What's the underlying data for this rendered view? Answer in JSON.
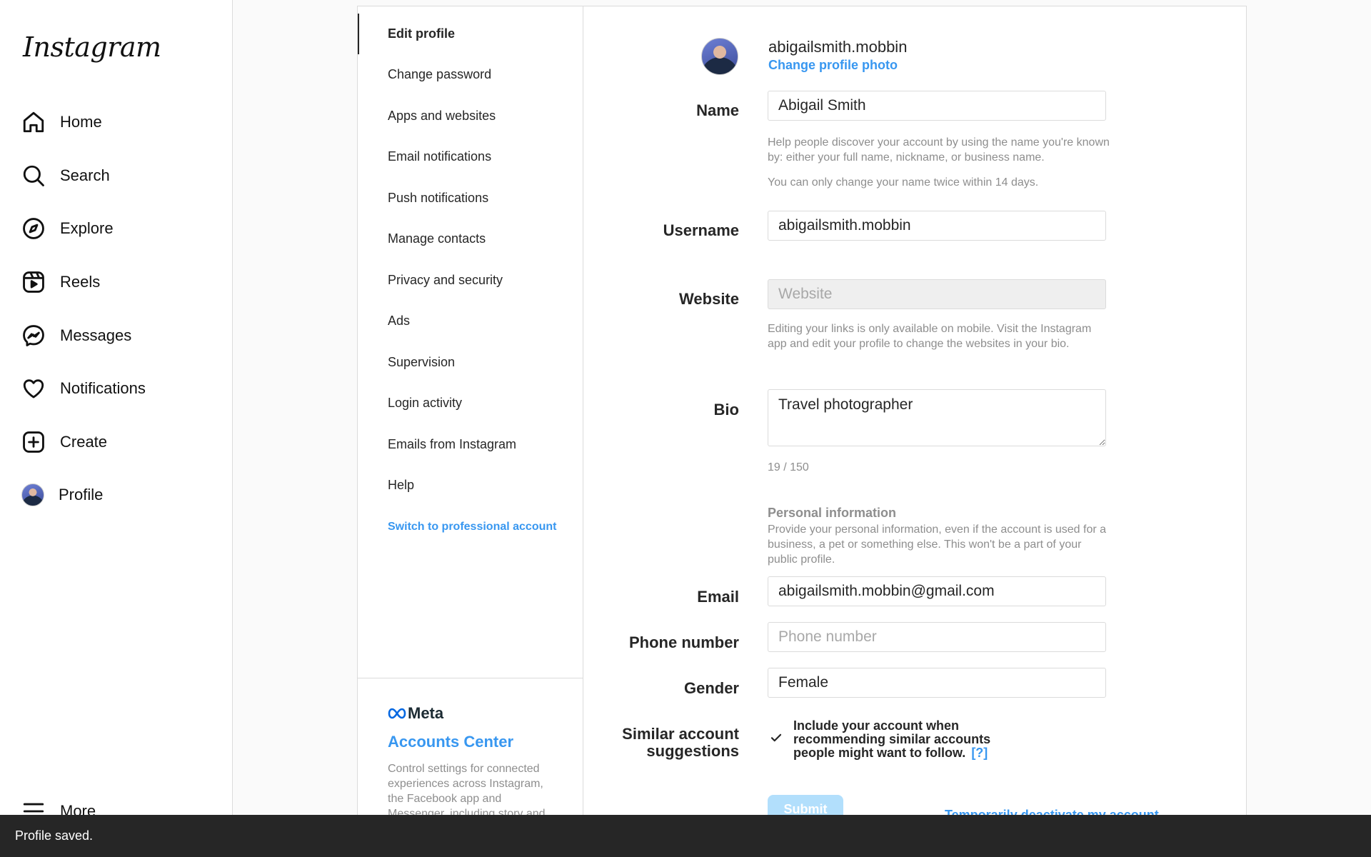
{
  "app": {
    "logo_text": "Instagram"
  },
  "nav": {
    "items": [
      {
        "label": "Home",
        "icon": "home-icon"
      },
      {
        "label": "Search",
        "icon": "search-icon"
      },
      {
        "label": "Explore",
        "icon": "compass-icon"
      },
      {
        "label": "Reels",
        "icon": "reels-icon"
      },
      {
        "label": "Messages",
        "icon": "messenger-icon"
      },
      {
        "label": "Notifications",
        "icon": "heart-icon"
      },
      {
        "label": "Create",
        "icon": "plus-square-icon"
      },
      {
        "label": "Profile",
        "icon": "avatar"
      }
    ],
    "more_label": "More"
  },
  "settings_menu": {
    "items": [
      "Edit profile",
      "Change password",
      "Apps and websites",
      "Email notifications",
      "Push notifications",
      "Manage contacts",
      "Privacy and security",
      "Ads",
      "Supervision",
      "Login activity",
      "Emails from Instagram",
      "Help"
    ],
    "active_item": "Edit profile",
    "switch_pro": "Switch to professional account",
    "meta": {
      "logo_text": "Meta",
      "accounts_center": "Accounts Center",
      "description": "Control settings for connected experiences across Instagram, the Facebook app and Messenger, including story and"
    }
  },
  "profile": {
    "username": "abigailsmith.mobbin",
    "change_photo": "Change profile photo"
  },
  "form": {
    "name": {
      "label": "Name",
      "value": "Abigail Smith",
      "help1": "Help people discover your account by using the name you're known by: either your full name, nickname, or business name.",
      "help2": "You can only change your name twice within 14 days."
    },
    "username": {
      "label": "Username",
      "value": "abigailsmith.mobbin"
    },
    "website": {
      "label": "Website",
      "placeholder": "Website",
      "help": "Editing your links is only available on mobile. Visit the Instagram app and edit your profile to change the websites in your bio."
    },
    "bio": {
      "label": "Bio",
      "value": "Travel photographer",
      "counter": "19 / 150"
    },
    "personal_info": {
      "title": "Personal information",
      "description": "Provide your personal information, even if the account is used for a business, a pet or something else. This won't be a part of your public profile."
    },
    "email": {
      "label": "Email",
      "value": "abigailsmith.mobbin@gmail.com"
    },
    "phone": {
      "label": "Phone number",
      "placeholder": "Phone number"
    },
    "gender": {
      "label": "Gender",
      "value": "Female"
    },
    "similar": {
      "label": "Similar account suggestions",
      "text": "Include your account when recommending similar accounts people might want to follow.",
      "help_link": "[?]",
      "checked": true
    },
    "submit": "Submit",
    "deactivate": "Temporarily deactivate my account"
  },
  "toast": {
    "message": "Profile saved."
  },
  "colors": {
    "accent": "#3897f0",
    "text": "#262626",
    "muted": "#8e8e8e",
    "border": "#dbdbdb"
  }
}
